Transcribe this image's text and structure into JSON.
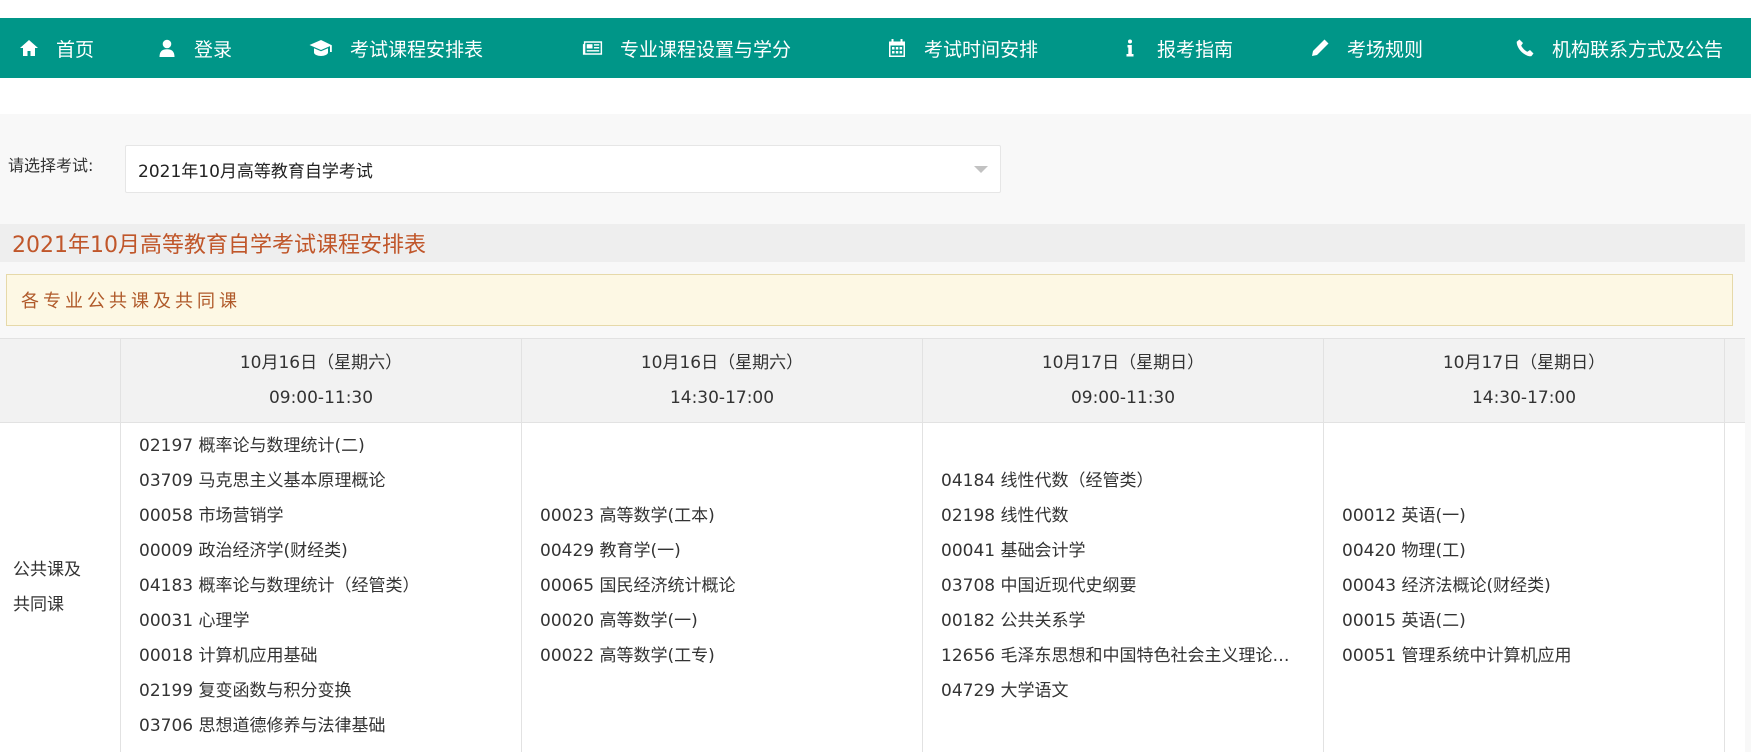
{
  "nav": {
    "items": [
      {
        "label": "首页",
        "icon": "home-icon"
      },
      {
        "label": "登录",
        "icon": "user-icon"
      },
      {
        "label": "考试课程安排表",
        "icon": "graduation-cap-icon"
      },
      {
        "label": "专业课程设置与学分",
        "icon": "newspaper-icon"
      },
      {
        "label": "考试时间安排",
        "icon": "calendar-icon"
      },
      {
        "label": "报考指南",
        "icon": "info-icon"
      },
      {
        "label": "考场规则",
        "icon": "pencil-icon"
      },
      {
        "label": "机构联系方式及公告",
        "icon": "phone-icon"
      }
    ],
    "color": "#009688"
  },
  "exam_select": {
    "label": "请选择考试:",
    "value": "2021年10月高等教育自学考试"
  },
  "table_title": "2021年10月高等教育自学考试课程安排表",
  "section_notice": "各专业公共课及共同课",
  "schedule": {
    "columns": [
      {
        "date": "10月16日（星期六）",
        "time": "09:00-11:30"
      },
      {
        "date": "10月16日（星期六）",
        "time": "14:30-17:00"
      },
      {
        "date": "10月17日（星期日）",
        "time": "09:00-11:30"
      },
      {
        "date": "10月17日（星期日）",
        "time": "14:30-17:00"
      }
    ],
    "row_label_line1": "公共课及",
    "row_label_line2": "共同课",
    "cells": [
      [
        "02197 概率论与数理统计(二)",
        "03709 马克思主义基本原理概论",
        "00058 市场营销学",
        "00009 政治经济学(财经类)",
        "04183 概率论与数理统计（经管类）",
        "00031 心理学",
        "00018 计算机应用基础",
        "02199 复变函数与积分变换",
        "03706 思想道德修养与法律基础"
      ],
      [
        "00023 高等数学(工本)",
        "00429 教育学(一)",
        "00065 国民经济统计概论",
        "00020 高等数学(一)",
        "00022 高等数学(工专)"
      ],
      [
        "04184 线性代数（经管类）",
        "02198 线性代数",
        "00041 基础会计学",
        "03708 中国近现代史纲要",
        "00182 公共关系学",
        "12656 毛泽东思想和中国特色社会主义理论…",
        "04729 大学语文"
      ],
      [
        "00012 英语(一)",
        "00420 物理(工)",
        "00043 经济法概论(财经类)",
        "00015 英语(二)",
        "00051 管理系统中计算机应用"
      ]
    ]
  }
}
